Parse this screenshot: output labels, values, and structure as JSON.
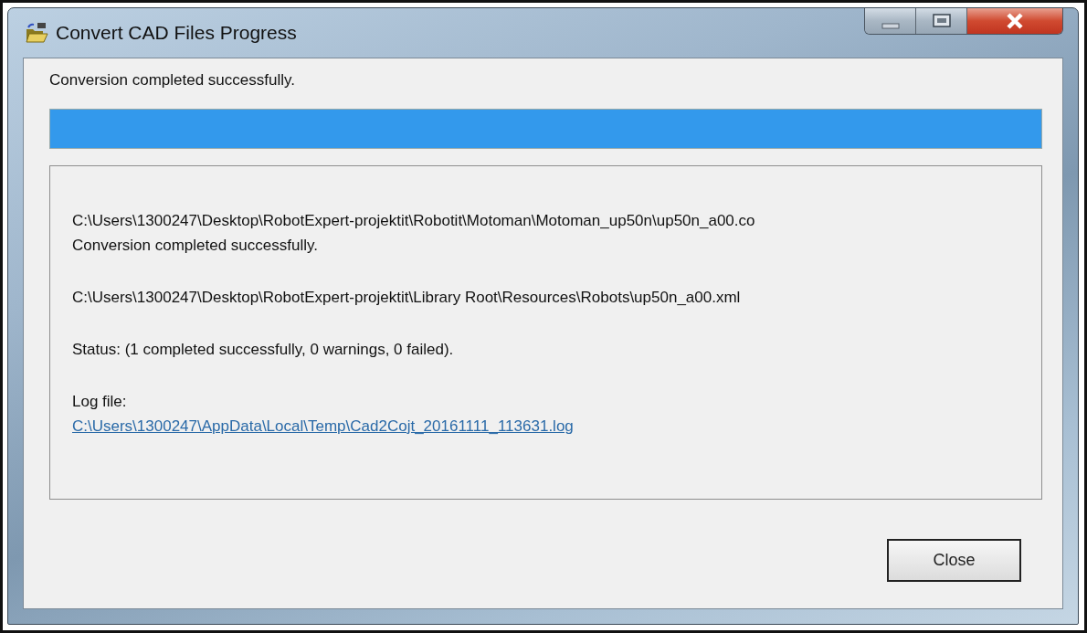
{
  "window": {
    "title": "Convert CAD Files Progress"
  },
  "message": "Conversion completed successfully.",
  "progress": {
    "level": 1
  },
  "log": [
    {
      "lines": [
        {
          "kind": "text",
          "text": "C:\\Users\\1300247\\Desktop\\RobotExpert-projektit\\Robotit\\Motoman\\Motoman_up50n\\up50n_a00.co"
        },
        {
          "kind": "text",
          "text": "Conversion completed successfully."
        }
      ]
    },
    {
      "lines": [
        {
          "kind": "text",
          "text": "C:\\Users\\1300247\\Desktop\\RobotExpert-projektit\\Library Root\\Resources\\Robots\\up50n_a00.xml"
        }
      ]
    },
    {
      "lines": [
        {
          "kind": "text",
          "text": "Status: (1 completed successfully, 0 warnings, 0 failed)."
        }
      ]
    },
    {
      "lines": [
        {
          "kind": "text",
          "text": "Log file:"
        },
        {
          "kind": "link",
          "text": "C:\\Users\\1300247\\AppData\\Local\\Temp\\Cad2Cojt_20161111_113631.log"
        }
      ]
    }
  ],
  "buttons": [
    {
      "label": "Close"
    }
  ]
}
